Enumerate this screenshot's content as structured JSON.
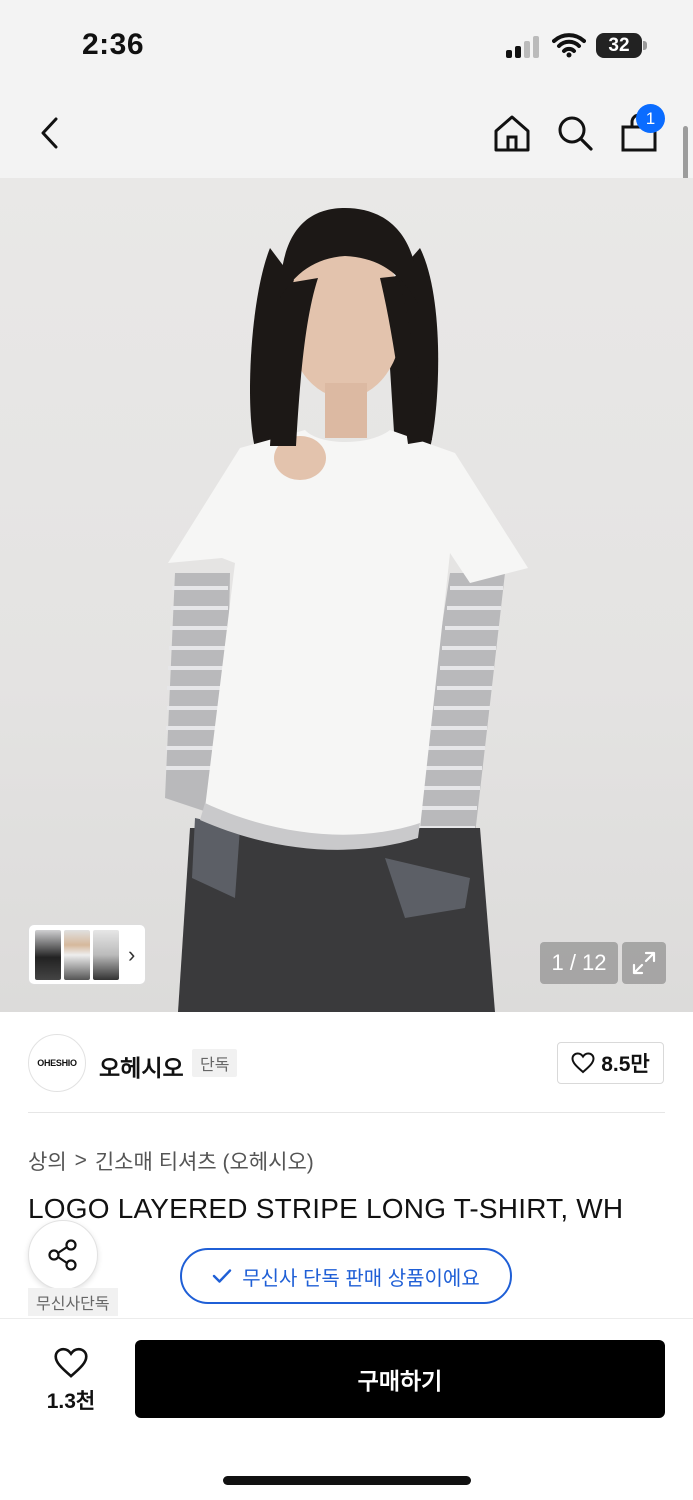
{
  "status_bar": {
    "time": "2:36",
    "battery": "32"
  },
  "nav": {
    "back_icon": "chevron-left-icon",
    "home_icon": "home-icon",
    "search_icon": "search-icon",
    "cart_icon": "shopping-bag-icon",
    "cart_count": "1"
  },
  "gallery": {
    "counter": "1 / 12",
    "thumbnail_arrow": "›"
  },
  "brand": {
    "logo_text": "OHESHIO",
    "name": "오헤시오",
    "tag": "단독",
    "like_count": "8.5만"
  },
  "breadcrumb": {
    "category": "상의",
    "separator": ">",
    "subcategory": "긴소매 티셔츠 (오헤시오)"
  },
  "product": {
    "title": "LOGO LAYERED STRIPE LONG T-SHIRT, WH"
  },
  "share": {
    "label": "무신사단독"
  },
  "exclusive_pill": {
    "label": "무신사 단독 판매 상품이에요"
  },
  "bottom_bar": {
    "like_count": "1.3천",
    "buy_label": "구매하기"
  },
  "colors": {
    "accent_blue": "#1f5fd6",
    "badge_blue": "#0a6cff",
    "buy_button": "#000000"
  }
}
